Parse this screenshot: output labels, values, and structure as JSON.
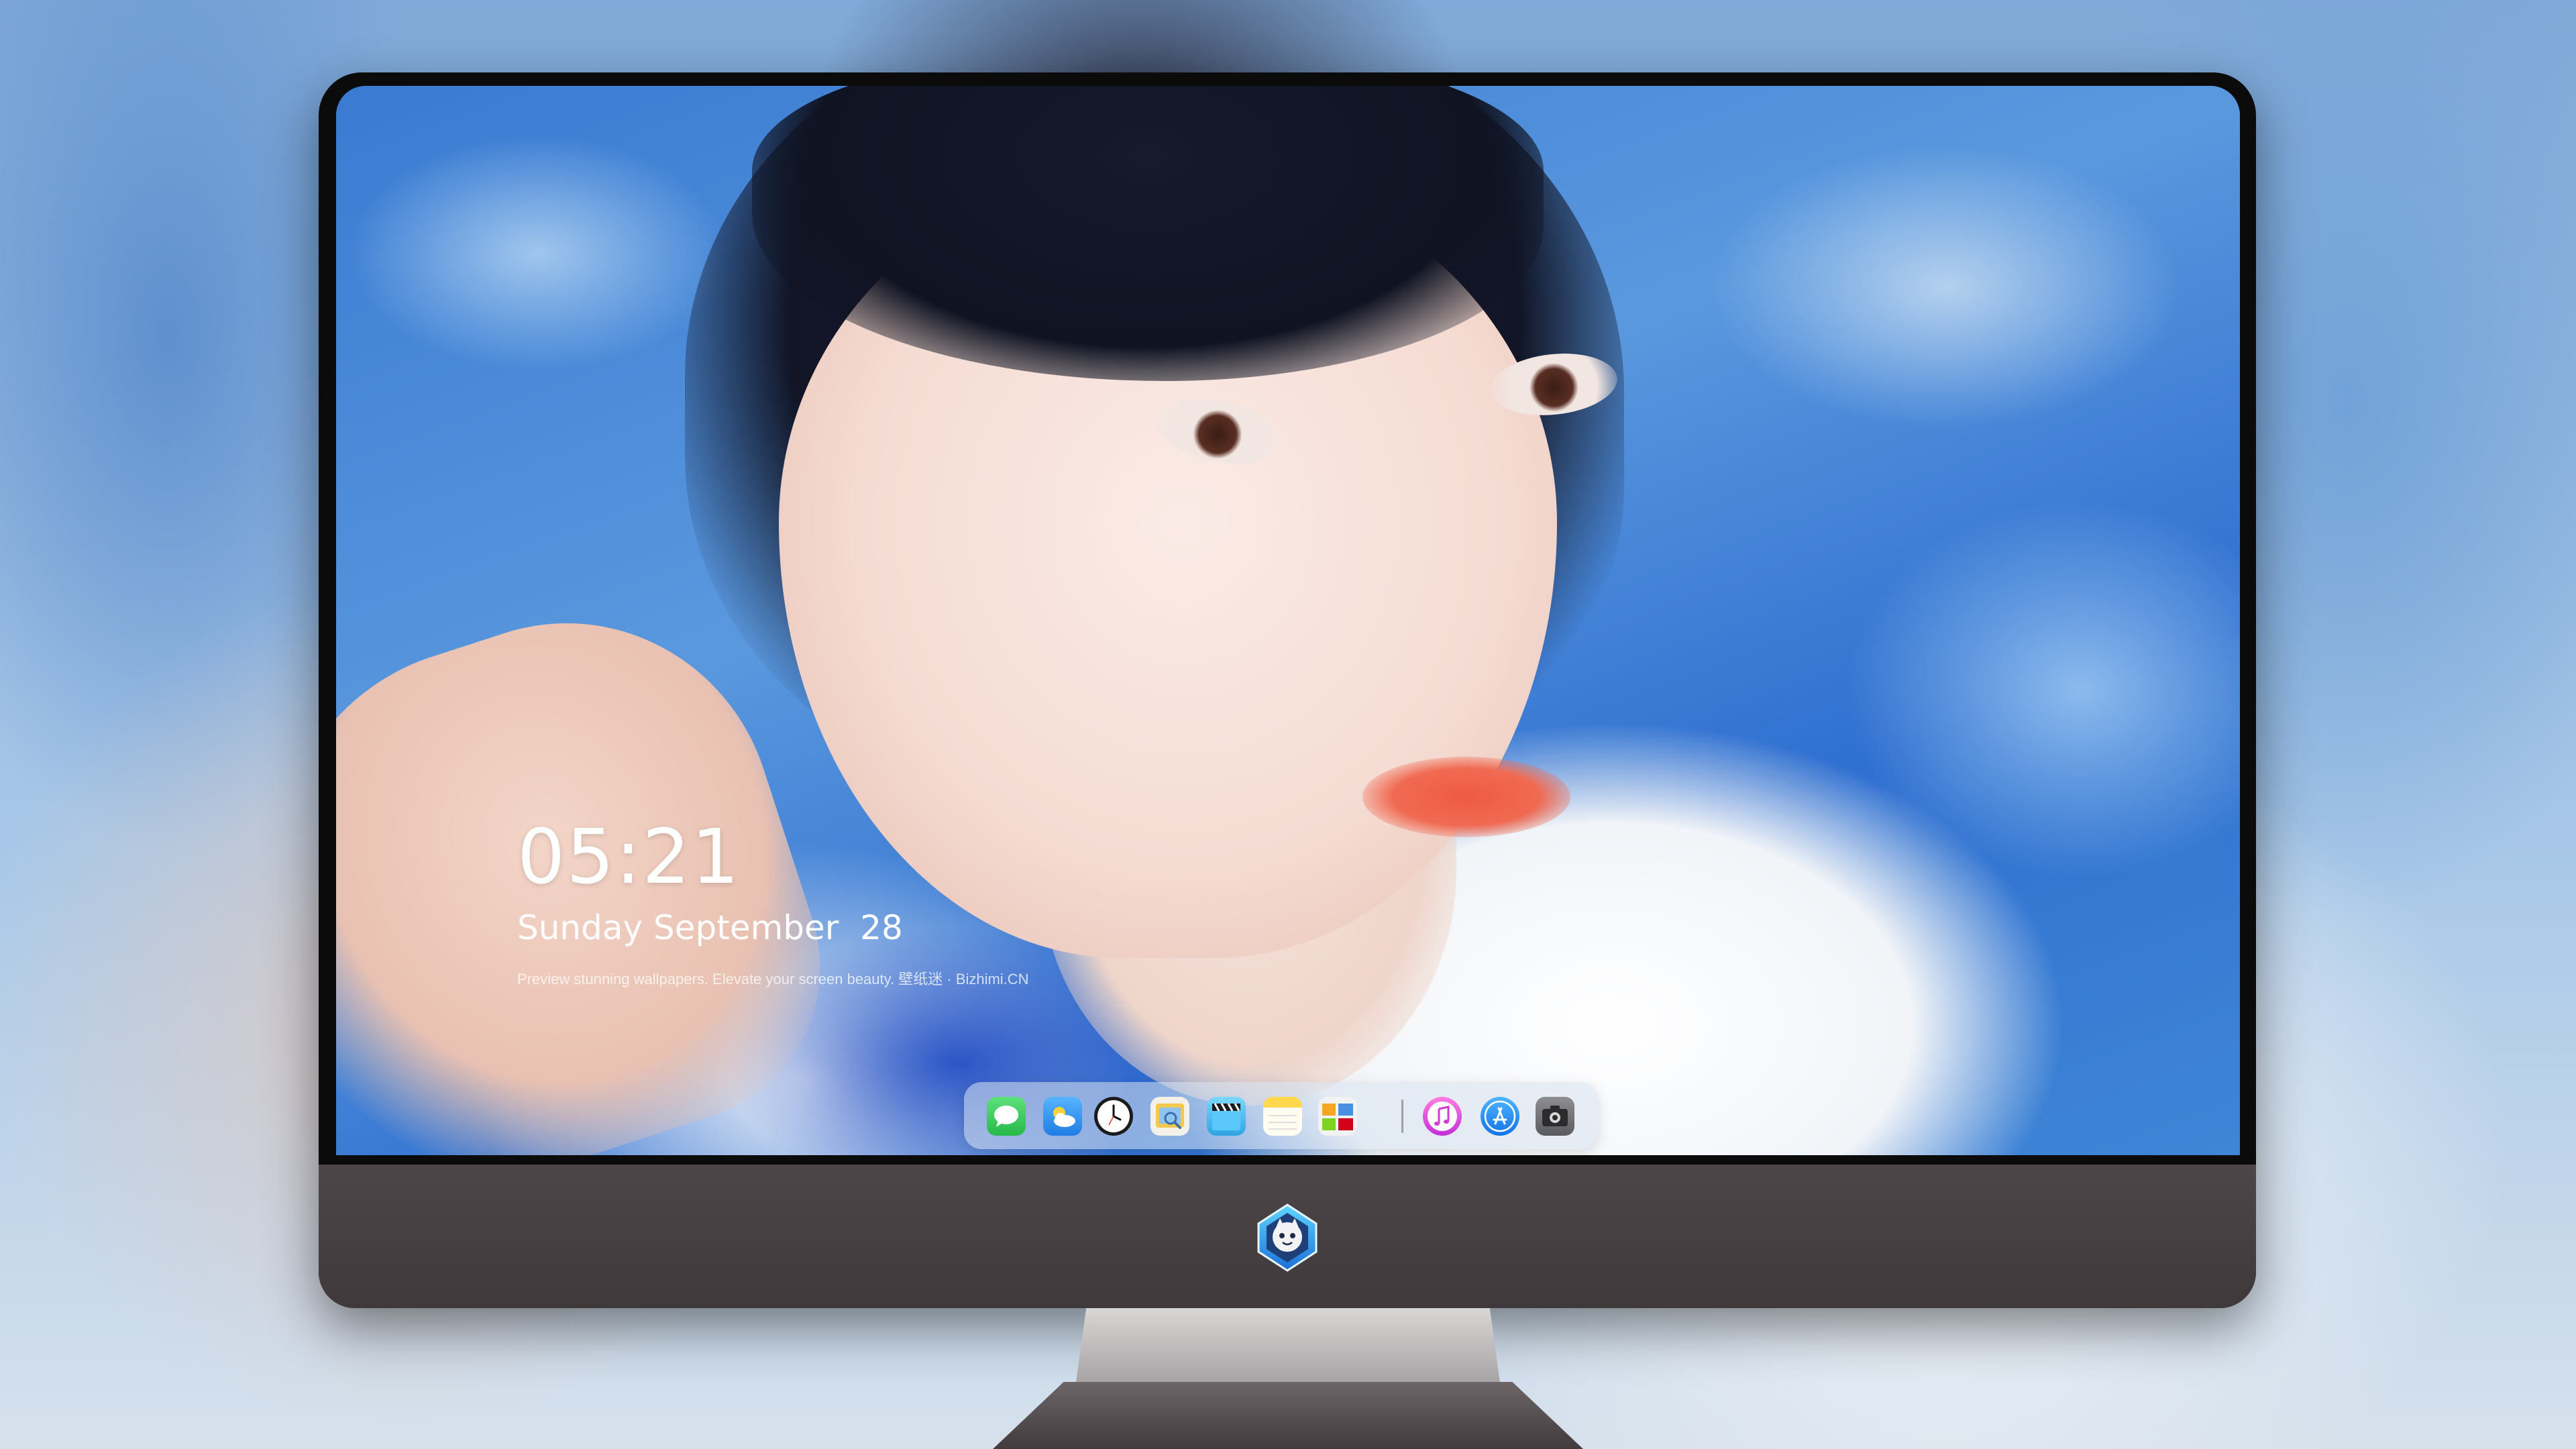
{
  "lock_screen": {
    "time": "05:21",
    "date": "Sunday September  28",
    "caption": "Preview stunning wallpapers. Elevate your screen beauty. 壁纸迷 · Bizhimi.CN"
  },
  "dock": {
    "apps": [
      {
        "name": "Messages",
        "icon": "messages-icon",
        "color": "#34c759"
      },
      {
        "name": "Weather",
        "icon": "weather-icon",
        "color": "#3d9cf0"
      },
      {
        "name": "Clock",
        "icon": "clock-icon",
        "color": "#1c1c1e"
      },
      {
        "name": "Preview",
        "icon": "preview-icon",
        "color": "#f2c94c"
      },
      {
        "name": "Clips",
        "icon": "clapperboard-icon",
        "color": "#5ac8fa"
      },
      {
        "name": "Notes",
        "icon": "notes-icon",
        "color": "#ffd84d"
      },
      {
        "name": "Photos Gallery",
        "icon": "gallery-icon",
        "color": "#e6e6e6"
      },
      {
        "name": "Music",
        "icon": "music-note-icon",
        "color": "#e040c8"
      },
      {
        "name": "App Store",
        "icon": "app-store-icon",
        "color": "#1f8ff5"
      },
      {
        "name": "Camera",
        "icon": "camera-icon",
        "color": "#6e6e73"
      }
    ]
  },
  "chin": {
    "logo_icon": "bizhimi-logo-icon"
  }
}
